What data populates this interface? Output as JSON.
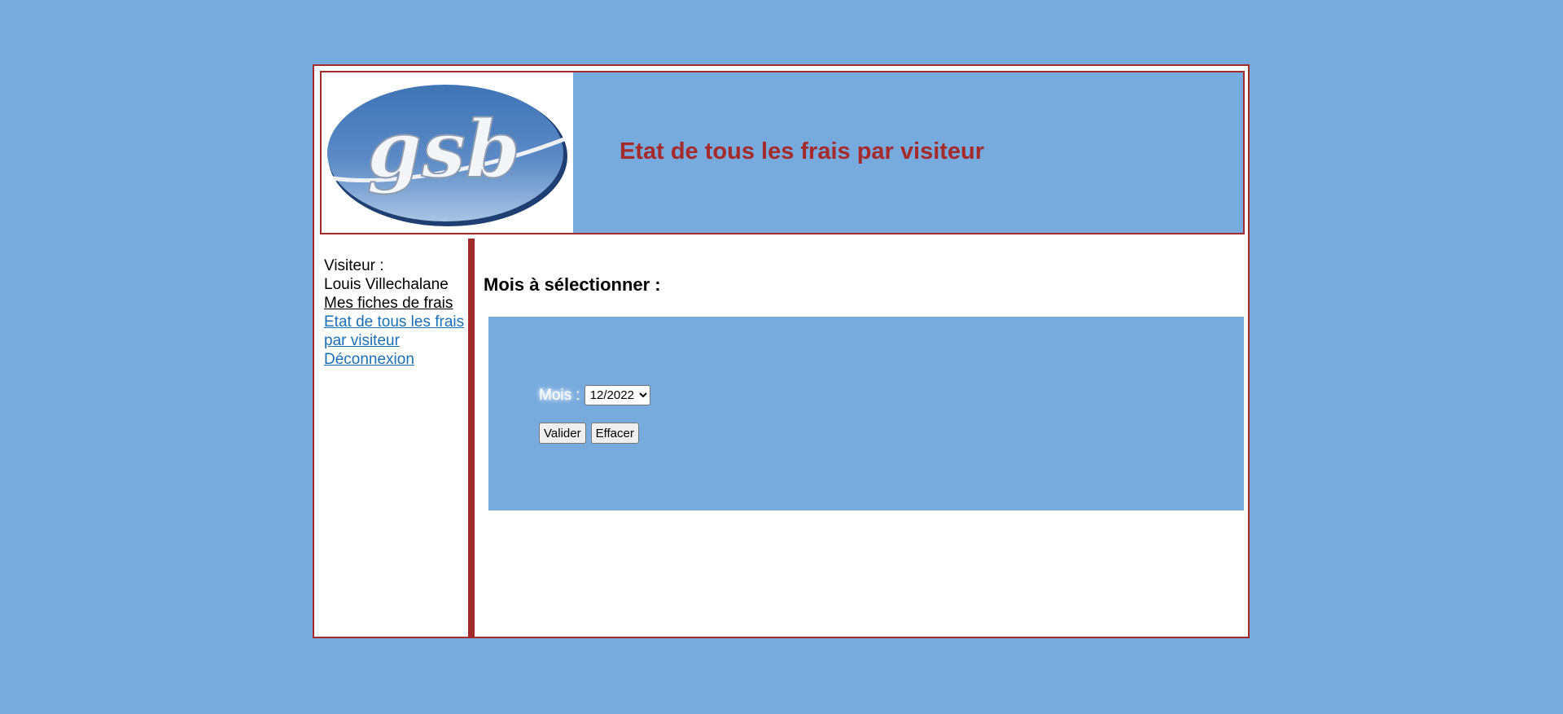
{
  "header": {
    "logo_text": "gsb",
    "title": "Etat de tous les frais par visiteur"
  },
  "sidebar": {
    "visitor_label": "Visiteur :",
    "visitor_name": "Louis Villechalane",
    "items": [
      {
        "label": "Mes fiches de frais"
      },
      {
        "label": "Etat de tous les frais par visiteur"
      },
      {
        "label": "Déconnexion"
      }
    ]
  },
  "main": {
    "heading": "Mois à sélectionner :",
    "form": {
      "month_label": "Mois :",
      "month_selected": "12/2022",
      "submit_label": "Valider",
      "reset_label": "Effacer"
    }
  },
  "colors": {
    "background": "#77aadd",
    "accent": "#a52a2a",
    "link": "#1a6fb5"
  }
}
